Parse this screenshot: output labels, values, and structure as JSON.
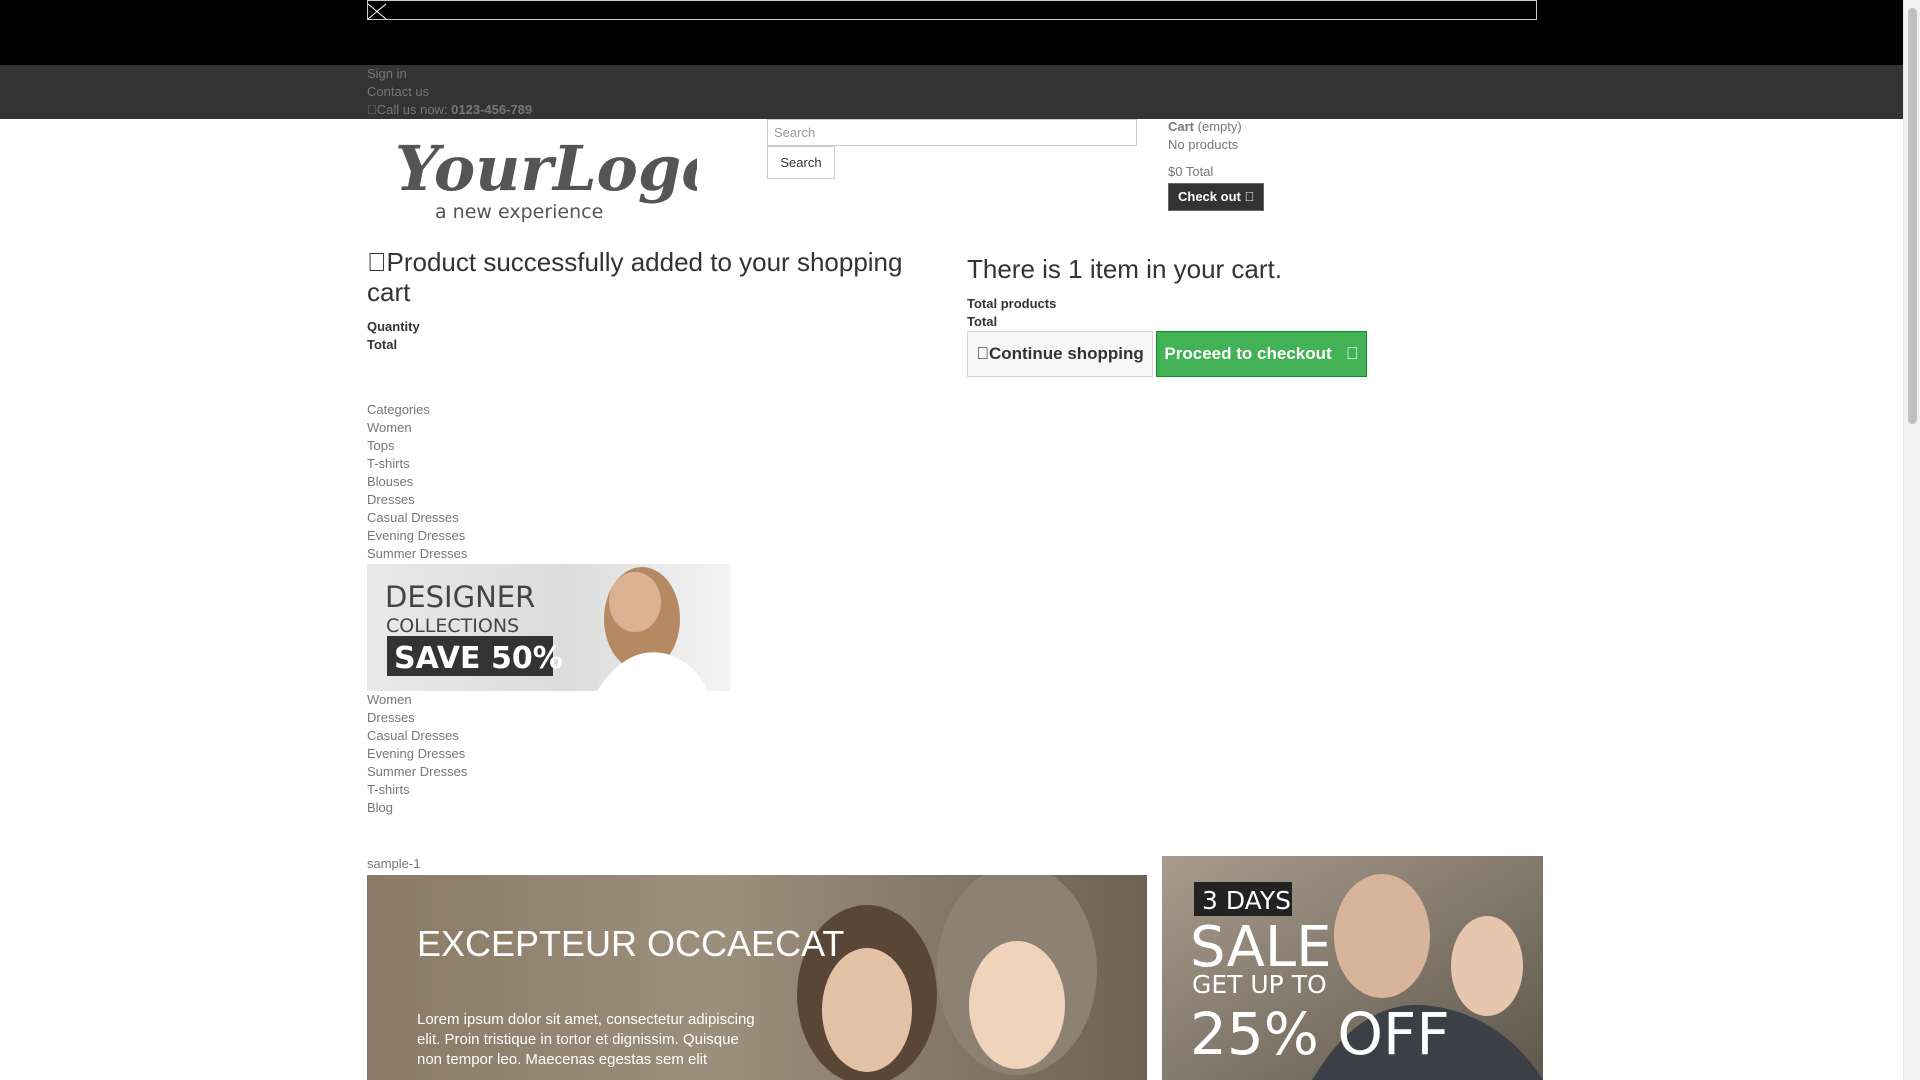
{
  "header": {
    "nav": {
      "sign_in": "Sign in",
      "contact_us": "Contact us",
      "call_prefix": "Call us now: ",
      "phone": "0123-456-789"
    },
    "logo": {
      "main": "YourLogo",
      "tagline": "a new experience"
    },
    "search": {
      "placeholder": "Search",
      "button": "Search"
    },
    "cart": {
      "title": "Cart",
      "status": "(empty)",
      "no_products": "No products",
      "total": "$0 Total",
      "checkout": "Check out"
    }
  },
  "layer_cart": {
    "success_title": "Product successfully added to your shopping cart",
    "quantity_label": "Quantity",
    "total_label": "Total",
    "count_text": "There is 1 item in your cart.",
    "total_products_label": "Total products",
    "total_label2": "Total",
    "continue_label": "Continue shopping",
    "proceed_label": "Proceed to checkout"
  },
  "categories": {
    "title": "Categories",
    "items": [
      "Women",
      "Tops",
      "T-shirts",
      "Blouses",
      "Dresses",
      "Casual Dresses",
      "Evening Dresses",
      "Summer Dresses"
    ]
  },
  "designer_banner": {
    "line1": "DESIGNER",
    "line2": "COLLECTIONS",
    "line3": "SAVE 50%"
  },
  "submenu": {
    "women_alt": "Women",
    "items": [
      "Dresses",
      "Casual Dresses",
      "Evening Dresses",
      "Summer Dresses",
      "T-shirts",
      "Blog"
    ]
  },
  "slider": {
    "alt": "sample-1",
    "title": "EXCEPTEUR OCCAECAT",
    "text": "Lorem ipsum dolor sit amet, consectetur adipiscing elit. Proin tristique in tortor et dignissim. Quisque non tempor leo. Maecenas egestas sem elit"
  },
  "sale_banner": {
    "line1": "3 DAYS",
    "line2": "SALE",
    "line3": "GET UP TO",
    "line4": "25% OFF"
  },
  "colors": {
    "topbar": "#000000",
    "navbar": "#333333",
    "proceed_green": "#43b155",
    "checkout_dark": "#333333"
  }
}
